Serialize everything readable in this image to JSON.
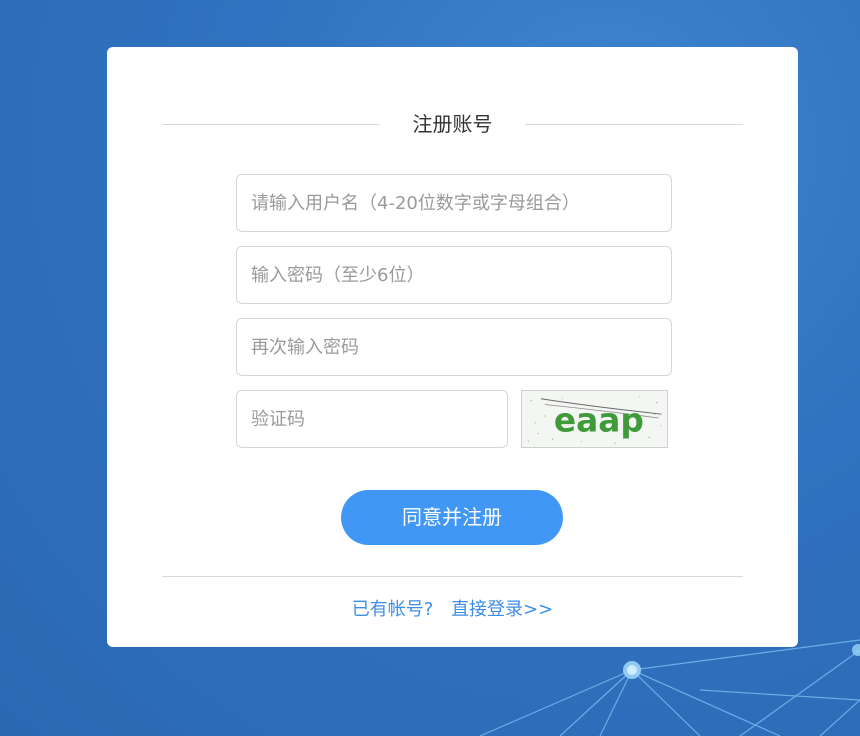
{
  "page": {
    "title": "注册账号"
  },
  "form": {
    "username_placeholder": "请输入用户名（4-20位数字或字母组合）",
    "password_placeholder": "输入密码（至少6位）",
    "confirm_password_placeholder": "再次输入密码",
    "captcha_placeholder": "验证码",
    "captcha_text": "eaap",
    "submit_label": "同意并注册"
  },
  "footer": {
    "have_account_text": "已有帐号?",
    "login_link_text": "直接登录>>"
  },
  "colors": {
    "background": "#2f72bf",
    "primary_button": "#4197f5",
    "link": "#3d8ee8",
    "captcha_text": "#3f9b3a"
  }
}
